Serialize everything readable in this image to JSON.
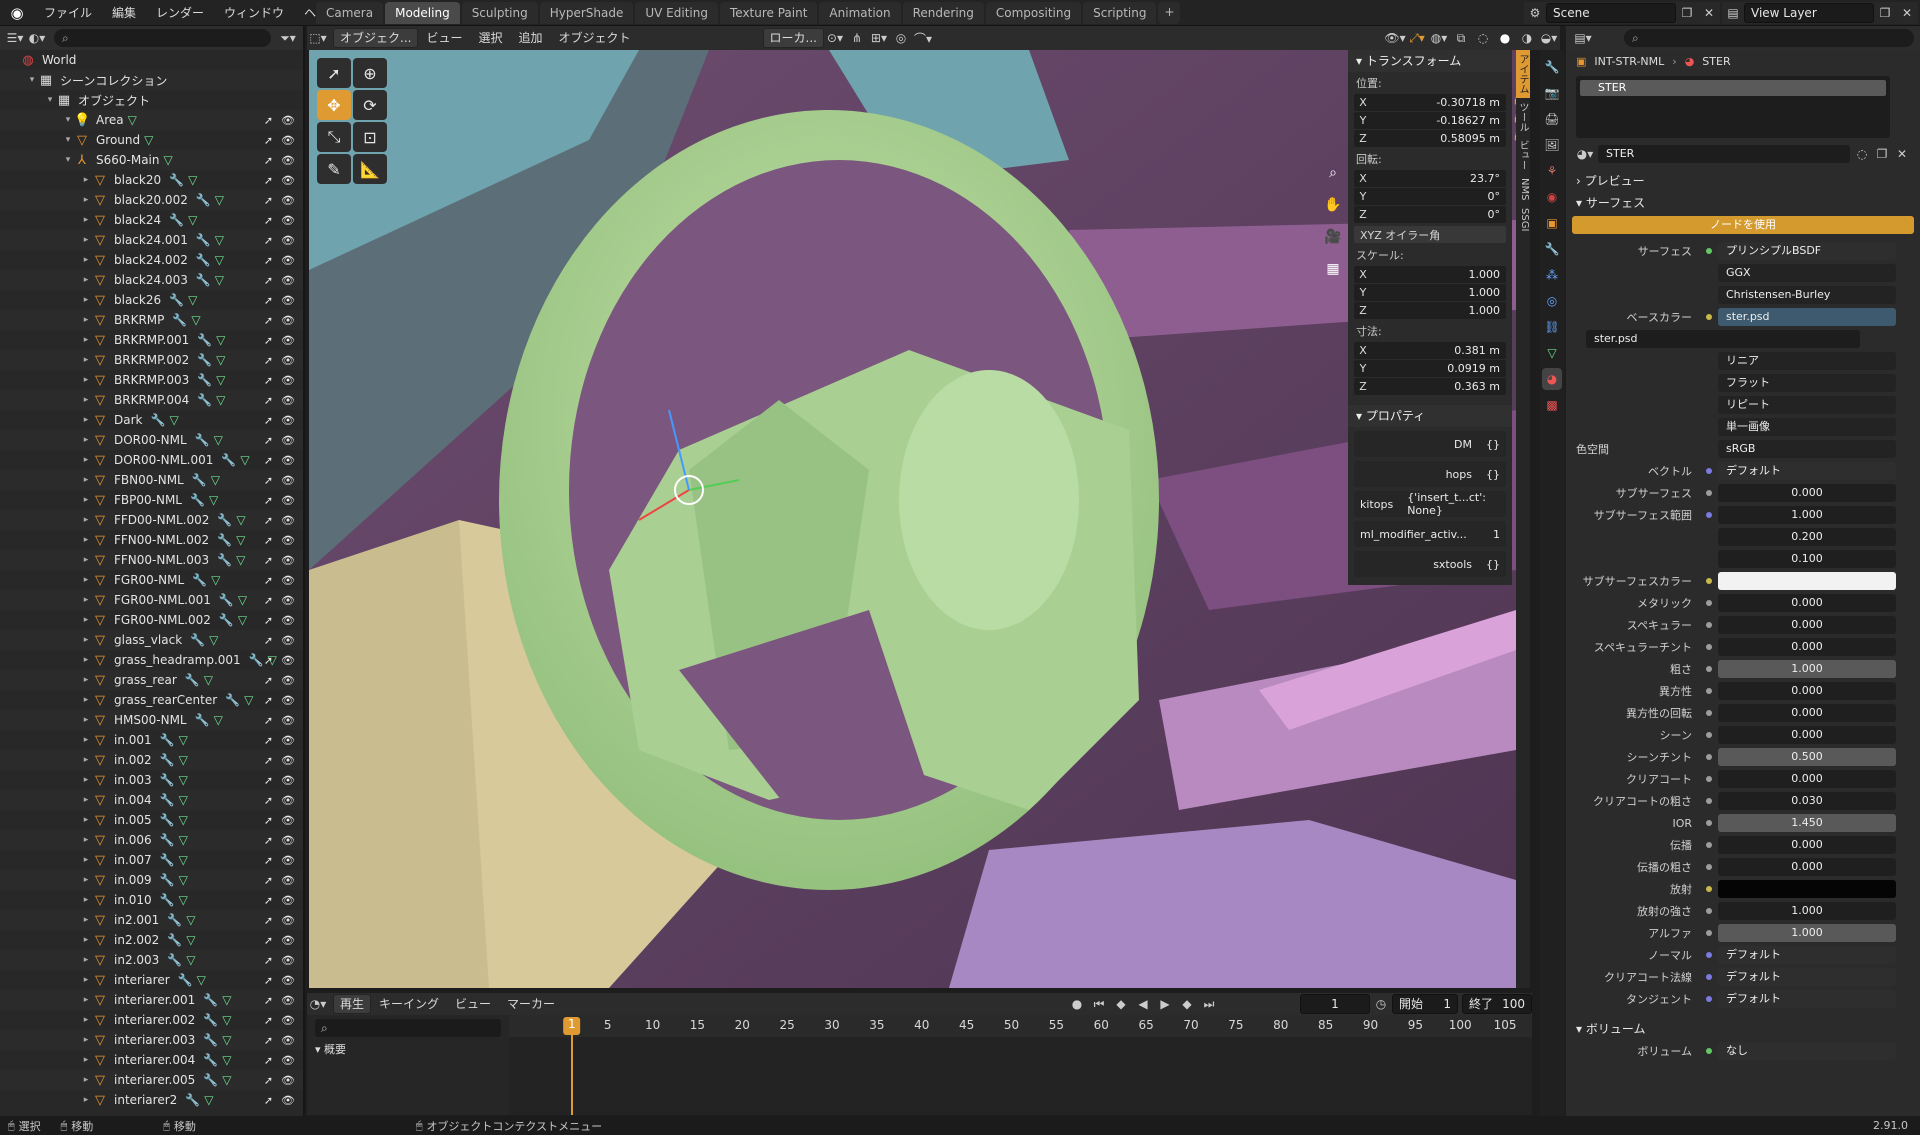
{
  "menu": [
    "ファイル",
    "編集",
    "レンダー",
    "ウィンドウ",
    "ヘルプ"
  ],
  "workspaces": [
    "Camera",
    "Modeling",
    "Sculpting",
    "HyperShade",
    "UV Editing",
    "Texture Paint",
    "Animation",
    "Rendering",
    "Compositing",
    "Scripting"
  ],
  "active_workspace": "Modeling",
  "scene": "Scene",
  "view_layer": "View Layer",
  "viewport_header": {
    "mode": "オブジェク...",
    "view": "ビュー",
    "select": "選択",
    "add": "追加",
    "object": "オブジェクト",
    "transform_orient": "ローカ..."
  },
  "outliner": {
    "rows": [
      {
        "label": "World",
        "icon": "world-icon",
        "indent": 0,
        "type": "world"
      },
      {
        "label": "シーンコレクション",
        "icon": "collection-icon",
        "indent": 1,
        "type": "collection"
      },
      {
        "label": "オブジェクト",
        "icon": "collection-icon",
        "indent": 2,
        "type": "collection"
      },
      {
        "label": "Area",
        "icon": "light-icon",
        "indent": 3,
        "type": "light"
      },
      {
        "label": "Ground",
        "icon": "mesh-icon",
        "indent": 3,
        "type": "mesh"
      },
      {
        "label": "S660-Main",
        "icon": "armature-icon",
        "indent": 3,
        "type": "parent"
      },
      {
        "label": "black20",
        "indent": 4
      },
      {
        "label": "black20.002",
        "indent": 4
      },
      {
        "label": "black24",
        "indent": 4
      },
      {
        "label": "black24.001",
        "indent": 4
      },
      {
        "label": "black24.002",
        "indent": 4
      },
      {
        "label": "black24.003",
        "indent": 4
      },
      {
        "label": "black26",
        "indent": 4
      },
      {
        "label": "BRKRMP",
        "indent": 4
      },
      {
        "label": "BRKRMP.001",
        "indent": 4
      },
      {
        "label": "BRKRMP.002",
        "indent": 4
      },
      {
        "label": "BRKRMP.003",
        "indent": 4
      },
      {
        "label": "BRKRMP.004",
        "indent": 4
      },
      {
        "label": "Dark",
        "indent": 4
      },
      {
        "label": "DOR00-NML",
        "indent": 4
      },
      {
        "label": "DOR00-NML.001",
        "indent": 4
      },
      {
        "label": "FBN00-NML",
        "indent": 4
      },
      {
        "label": "FBP00-NML",
        "indent": 4
      },
      {
        "label": "FFD00-NML.002",
        "indent": 4
      },
      {
        "label": "FFN00-NML.002",
        "indent": 4
      },
      {
        "label": "FFN00-NML.003",
        "indent": 4
      },
      {
        "label": "FGR00-NML",
        "indent": 4
      },
      {
        "label": "FGR00-NML.001",
        "indent": 4
      },
      {
        "label": "FGR00-NML.002",
        "indent": 4
      },
      {
        "label": "glass_vlack",
        "indent": 4
      },
      {
        "label": "grass_headramp.001",
        "indent": 4
      },
      {
        "label": "grass_rear",
        "indent": 4
      },
      {
        "label": "grass_rearCenter",
        "indent": 4
      },
      {
        "label": "HMS00-NML",
        "indent": 4
      },
      {
        "label": "in.001",
        "indent": 4
      },
      {
        "label": "in.002",
        "indent": 4
      },
      {
        "label": "in.003",
        "indent": 4
      },
      {
        "label": "in.004",
        "indent": 4
      },
      {
        "label": "in.005",
        "indent": 4
      },
      {
        "label": "in.006",
        "indent": 4
      },
      {
        "label": "in.007",
        "indent": 4
      },
      {
        "label": "in.009",
        "indent": 4
      },
      {
        "label": "in.010",
        "indent": 4
      },
      {
        "label": "in2.001",
        "indent": 4
      },
      {
        "label": "in2.002",
        "indent": 4
      },
      {
        "label": "in2.003",
        "indent": 4
      },
      {
        "label": "interiarer",
        "indent": 4
      },
      {
        "label": "interiarer.001",
        "indent": 4
      },
      {
        "label": "interiarer.002",
        "indent": 4
      },
      {
        "label": "interiarer.003",
        "indent": 4
      },
      {
        "label": "interiarer.004",
        "indent": 4
      },
      {
        "label": "interiarer.005",
        "indent": 4
      },
      {
        "label": "interiarer2",
        "indent": 4
      }
    ]
  },
  "npanel": {
    "transform_title": "トランスフォーム",
    "location_label": "位置:",
    "location": {
      "x": "-0.30718 m",
      "y": "-0.18627 m",
      "z": "0.58095 m"
    },
    "rotation_label": "回転:",
    "rotation": {
      "x": "23.7°",
      "y": "0°",
      "z": "0°"
    },
    "rotation_mode": "XYZ オイラー角",
    "scale_label": "スケール:",
    "scale": {
      "x": "1.000",
      "y": "1.000",
      "z": "1.000"
    },
    "dimensions_label": "寸法:",
    "dimensions": {
      "x": "0.381 m",
      "y": "0.0919 m",
      "z": "0.363 m"
    },
    "properties_title": "プロパティ",
    "custom_props": [
      {
        "name": "DM",
        "value": "{}"
      },
      {
        "name": "hops",
        "value": "{}"
      },
      {
        "name": "kitops",
        "value": "{'insert_t...ct': None}"
      },
      {
        "name": "ml_modifier_activ...",
        "value": "1"
      },
      {
        "name": "sxtools",
        "value": "{}"
      }
    ],
    "side_tabs": [
      "アイテム",
      "ツール",
      "ビュー",
      "NMS",
      "SSGI"
    ]
  },
  "timeline": {
    "play": "再生",
    "keying": "キーイング",
    "view": "ビュー",
    "marker": "マーカー",
    "current_frame": "1",
    "start_label": "開始",
    "start": "1",
    "end_label": "終了",
    "end": "100",
    "ruler": [
      "5",
      "10",
      "15",
      "20",
      "25",
      "30",
      "35",
      "40",
      "45",
      "50",
      "55",
      "60",
      "65",
      "70",
      "75",
      "80",
      "85",
      "90",
      "95",
      "100",
      "105"
    ],
    "playhead": "1",
    "summary": "概要"
  },
  "statusbar": {
    "select": "選択",
    "move": "移動",
    "move2": "移動",
    "context_menu": "オブジェクトコンテクストメニュー",
    "version": "2.91.0"
  },
  "properties": {
    "breadcrumb_object": "INT-STR-NML",
    "breadcrumb_material": "STER",
    "slot_name": "STER",
    "material_name": "STER",
    "preview": "プレビュー",
    "surface_section": "サーフェス",
    "use_nodes": "ノードを使用",
    "surface_label": "サーフェス",
    "surface_value": "プリンシプルBSDF",
    "distribution": "GGX",
    "subsurface_method": "Christensen-Burley",
    "base_color_label": "ベースカラー",
    "base_color_value": "ster.psd",
    "image_name": "ster.psd",
    "interp": "リニア",
    "projection": "フラット",
    "extension": "リピート",
    "source": "単一画像",
    "colorspace_label": "色空間",
    "colorspace": "sRGB",
    "vector_label": "ベクトル",
    "vector": "デフォルト",
    "subsurface_label": "サブサーフェス",
    "subsurface": "0.000",
    "ss_radius_label": "サブサーフェス範囲",
    "ss_radius": [
      "1.000",
      "0.200",
      "0.100"
    ],
    "ss_color_label": "サブサーフェスカラー",
    "rows": [
      {
        "label": "メタリック",
        "value": "0.000"
      },
      {
        "label": "スペキュラー",
        "value": "0.000"
      },
      {
        "label": "スペキュラーチント",
        "value": "0.000"
      },
      {
        "label": "粗さ",
        "value": "1.000"
      },
      {
        "label": "異方性",
        "value": "0.000"
      },
      {
        "label": "異方性の回転",
        "value": "0.000"
      },
      {
        "label": "シーン",
        "value": "0.000"
      },
      {
        "label": "シーンチント",
        "value": "0.500"
      },
      {
        "label": "クリアコート",
        "value": "0.000"
      },
      {
        "label": "クリアコートの粗さ",
        "value": "0.030"
      },
      {
        "label": "IOR",
        "value": "1.450"
      },
      {
        "label": "伝播",
        "value": "0.000"
      },
      {
        "label": "伝播の粗さ",
        "value": "0.000"
      }
    ],
    "emission_label": "放射",
    "emission_strength_label": "放射の強さ",
    "emission_strength": "1.000",
    "alpha_label": "アルファ",
    "alpha": "1.000",
    "normal_label": "ノーマル",
    "normal": "デフォルト",
    "cc_normal_label": "クリアコート法線",
    "cc_normal": "デフォルト",
    "tangent_label": "タンジェント",
    "tangent": "デフォルト",
    "volume_section": "ボリューム",
    "volume_label": "ボリューム",
    "volume": "なし"
  },
  "colors": {
    "accent": "#e09a32",
    "mesh_green": "#6ce08f",
    "modifier_blue": "#66a6ff",
    "object_orange": "#e8962f"
  }
}
